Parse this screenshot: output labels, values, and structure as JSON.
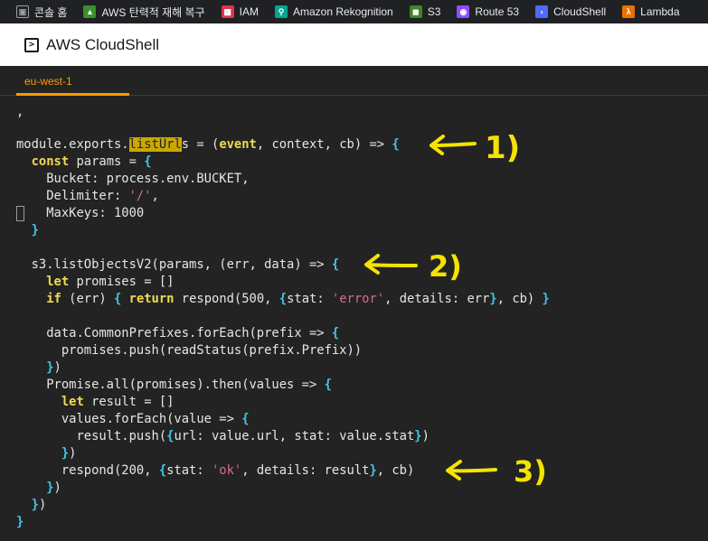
{
  "bookmarks": [
    {
      "label": "콘솔 홈",
      "icon": "cube-icon",
      "color": "#5f6368"
    },
    {
      "label": "AWS 탄력적 재해 복구",
      "icon": "drs-icon",
      "color": "#3a8f2e"
    },
    {
      "label": "IAM",
      "icon": "iam-icon",
      "color": "#dd344c"
    },
    {
      "label": "Amazon Rekognition",
      "icon": "rekognition-icon",
      "color": "#01a88d"
    },
    {
      "label": "S3",
      "icon": "s3-icon",
      "color": "#3f8624"
    },
    {
      "label": "Route 53",
      "icon": "route53-icon",
      "color": "#8c4fff"
    },
    {
      "label": "CloudShell",
      "icon": "cloudshell-icon",
      "color": "#4d6bfe"
    },
    {
      "label": "Lambda",
      "icon": "lambda-icon",
      "color": "#ed7100"
    }
  ],
  "header": {
    "title": "AWS CloudShell",
    "icon": "terminal-icon"
  },
  "tabs": [
    {
      "label": "eu-west-1",
      "active": true
    }
  ],
  "colors": {
    "accent": "#ff9900",
    "annotation": "#f5e300",
    "keyword": "#f0db4f",
    "bracket": "#41c8e6",
    "string": "#d66b8a"
  },
  "code": {
    "l0": ",",
    "l1_pre": "module.exports.",
    "l1_hl": "listUrl",
    "l1_mid": "s = (",
    "l1_event": "event",
    "l1_post": ", context, cb) => ",
    "l1_brace": "{",
    "l2_kw": "const",
    "l2_rest": " params = ",
    "l2_brace": "{",
    "l3": "    Bucket: process.env.BUCKET,",
    "l4_pre": "    Delimiter: ",
    "l4_str": "'/'",
    "l4_post": ",",
    "l5": "    MaxKeys: 1000",
    "l6": "}",
    "l8_pre": "  s3.listObjectsV2(params, (err, data) => ",
    "l8_brace": "{",
    "l9_kw": "let",
    "l9_rest": " promises = []",
    "l10_kw": "if",
    "l10_a": " (err) ",
    "l10_b1": "{",
    "l10_kw2": "return",
    "l10_c": " respond(500, ",
    "l10_b2": "{",
    "l10_d": "stat: ",
    "l10_str": "'error'",
    "l10_e": ", details: err",
    "l10_b3": "}",
    "l10_f": ", cb) ",
    "l10_b4": "}",
    "l12": "    data.CommonPrefixes.forEach(prefix => ",
    "l12_brace": "{",
    "l13": "      promises.push(readStatus(prefix.Prefix))",
    "l14_brace": "}",
    "l14_post": ")",
    "l15": "    Promise.all(promises).then(values => ",
    "l15_brace": "{",
    "l16_kw": "let",
    "l16_rest": " result = []",
    "l17": "      values.forEach(value => ",
    "l17_brace": "{",
    "l18_a": "        result.push(",
    "l18_b1": "{",
    "l18_b": "url: value.url, stat: value.stat",
    "l18_b2": "}",
    "l18_c": ")",
    "l19_brace": "}",
    "l19_post": ")",
    "l20_a": "      respond(200, ",
    "l20_b1": "{",
    "l20_b": "stat: ",
    "l20_str": "'ok'",
    "l20_c": ", details: result",
    "l20_b2": "}",
    "l20_d": ", cb)",
    "l21_brace": "}",
    "l21_post": ")",
    "l22_brace": "}",
    "l22_post": ")",
    "l23": "}"
  },
  "annotations": [
    "1)",
    "2)",
    "3)"
  ]
}
